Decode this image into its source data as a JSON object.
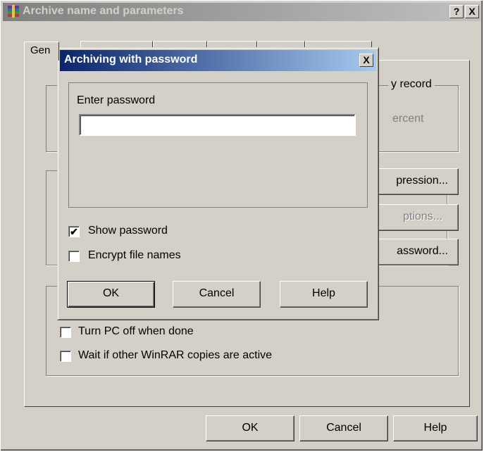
{
  "main_window": {
    "title": "Archive name and parameters",
    "help_btn": "?",
    "close_btn": "X",
    "tabs": [
      {
        "label": "Gen"
      },
      {
        "label": ""
      },
      {
        "label": ""
      },
      {
        "label": ""
      },
      {
        "label": ""
      },
      {
        "label": ""
      }
    ],
    "partial_text": {
      "recovery_record": "y record",
      "percent": "ercent",
      "compression_btn": "pression...",
      "options_btn": "ptions...",
      "password_btn": "assword..."
    },
    "checkboxes": [
      {
        "label": "Turn PC off when done",
        "checked": false
      },
      {
        "label": "Wait if other WinRAR copies are active",
        "checked": false
      }
    ],
    "buttons": {
      "ok": "OK",
      "cancel": "Cancel",
      "help": "Help"
    }
  },
  "password_dialog": {
    "title": "Archiving with password",
    "close_btn": "X",
    "prompt": "Enter password",
    "password_value": "",
    "checkboxes": [
      {
        "label": "Show password",
        "checked": true,
        "mark": "✔"
      },
      {
        "label": "Encrypt file names",
        "checked": false,
        "mark": ""
      }
    ],
    "buttons": {
      "ok": "OK",
      "cancel": "Cancel",
      "help": "Help"
    }
  },
  "colors": {
    "face": "#d4d0c8",
    "active_title_start": "#0a246a",
    "active_title_end": "#a6caf0",
    "inactive_title": "#808080"
  }
}
